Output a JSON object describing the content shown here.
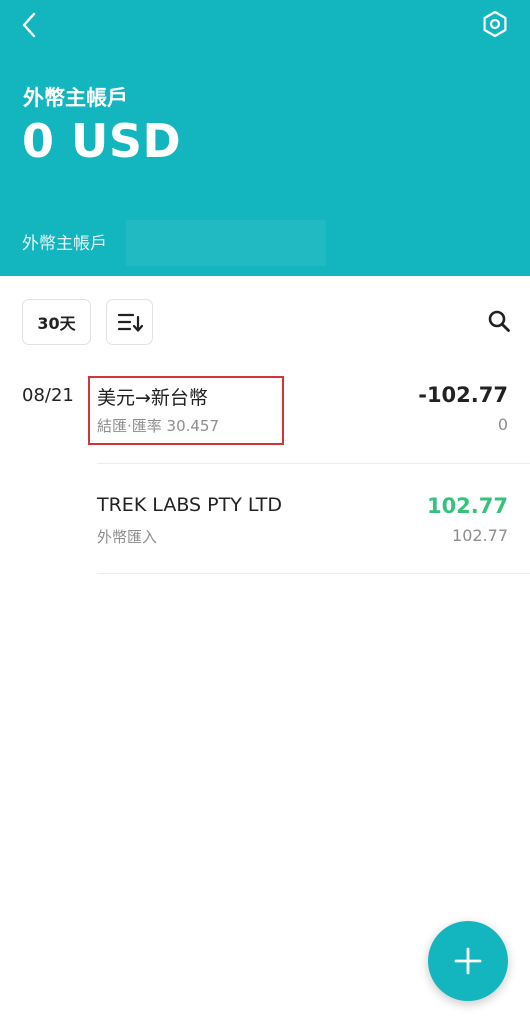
{
  "header": {
    "account_title": "外幣主帳戶",
    "balance": "0 USD",
    "account_sub_label": "外幣主帳戶",
    "back_icon": "chevron-left-icon",
    "settings_icon": "hexagon-gear-icon"
  },
  "toolbar": {
    "range_label": "30天",
    "sort_icon": "sort-list-icon",
    "search_icon": "search-icon"
  },
  "transactions": {
    "date": "08/21",
    "items": [
      {
        "title": "美元→新台幣",
        "subtitle": "結匯‧匯率 30.457",
        "amount": "-102.77",
        "balance": "0",
        "amount_color": "#222222"
      },
      {
        "title": "TREK LABS PTY LTD",
        "subtitle": "外幣匯入",
        "amount": "102.77",
        "balance": "102.77",
        "amount_color": "#35c27d"
      }
    ]
  },
  "fab": {
    "icon": "plus-icon"
  },
  "colors": {
    "accent": "#13b5bf",
    "positive": "#35c27d",
    "highlight": "#d2343a"
  }
}
